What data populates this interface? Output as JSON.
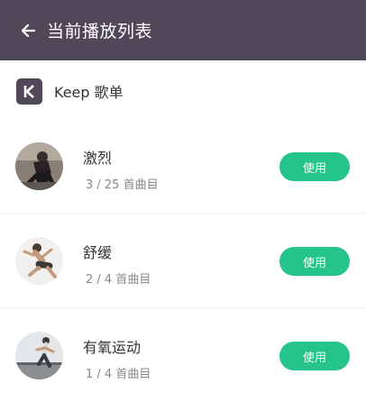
{
  "header": {
    "title": "当前播放列表",
    "back_icon": "arrow-left-icon"
  },
  "source": {
    "label": "Keep 歌单",
    "icon": "keep-logo-icon"
  },
  "colors": {
    "header_bg": "#4f4858",
    "accent": "#24c48a"
  },
  "playlists": [
    {
      "title": "激烈",
      "count": "3 / 25 首曲目",
      "button": "使用"
    },
    {
      "title": "舒缓",
      "count": "2 / 4 首曲目",
      "button": "使用"
    },
    {
      "title": "有氧运动",
      "count": "1 / 4 首曲目",
      "button": "使用"
    }
  ]
}
